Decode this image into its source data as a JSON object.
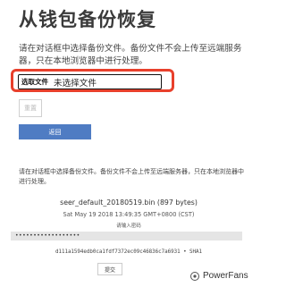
{
  "header": {
    "title": "从钱包备份恢复"
  },
  "upload": {
    "instructions": "请在对话框中选择备份文件。备份文件不会上传至远端服务器，只在本地浏览器中进行处理。",
    "choose_file_label": "选取文件",
    "no_file_text": "未选择文件",
    "reset_label": "重置",
    "back_label": "返回"
  },
  "restore": {
    "instructions": "请在对话框中选择备份文件。备份文件不会上传至远端服务器，只在本地浏览器中进行处理。",
    "file_name": "seer_default_20180519.bin (897 bytes)",
    "file_date": "Sat May 19 2018 13:49:35 GMT+0800 (CST)",
    "password_label": "请输入密码",
    "password_value": "••••••••••••••••••",
    "hash_text": "d111a1594edb0ca1fdf7372ec09c46836c7a6931 • SHA1",
    "submit_label": "提交"
  },
  "watermark": {
    "text": "PowerFans"
  }
}
